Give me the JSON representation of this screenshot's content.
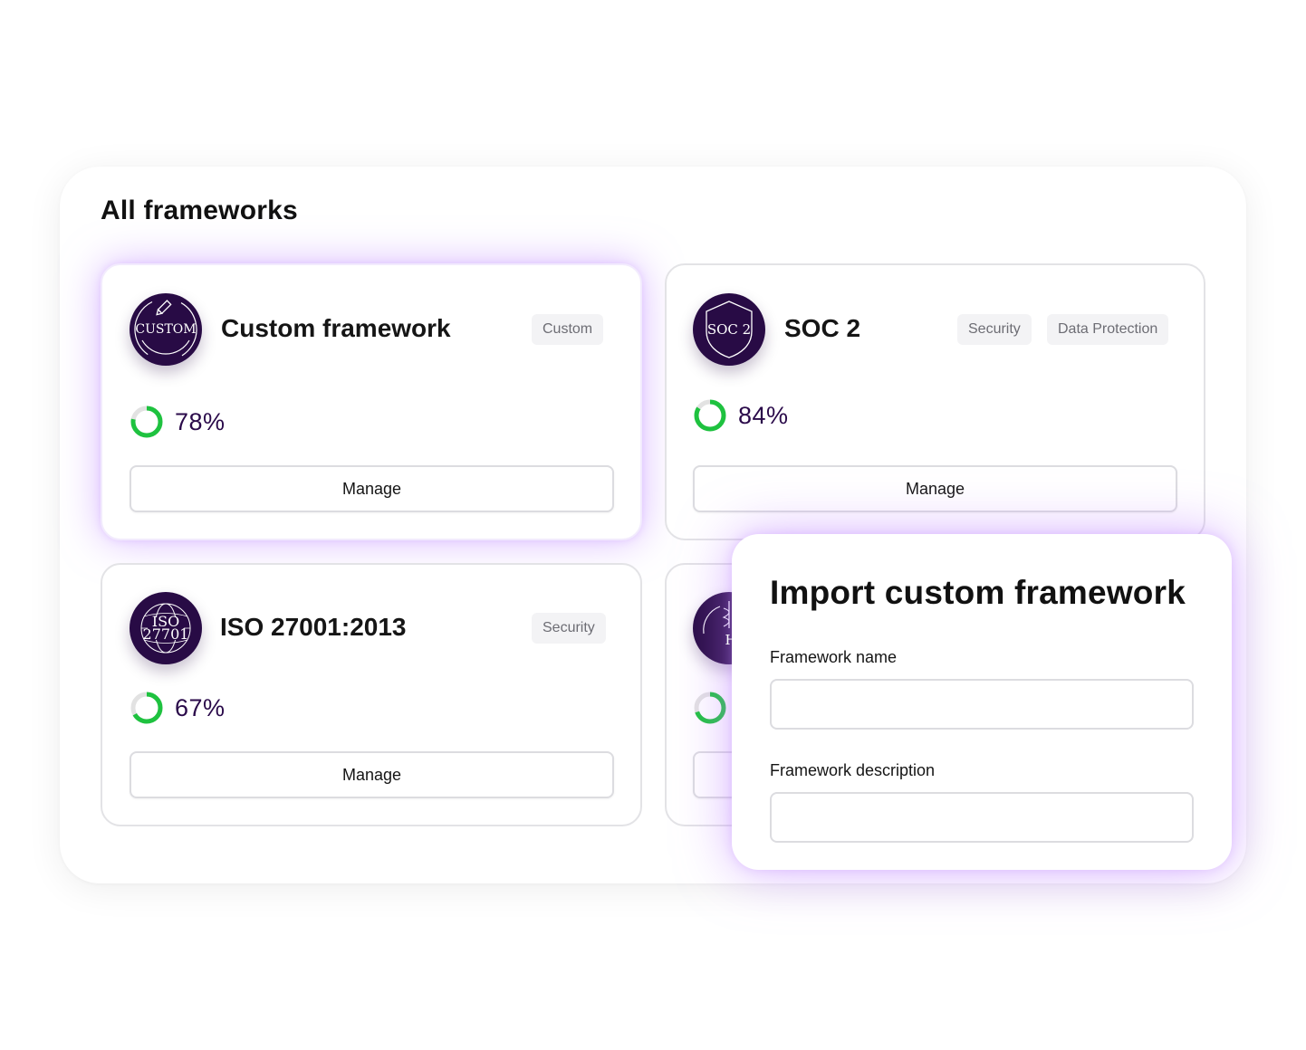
{
  "page": {
    "title": "All frameworks"
  },
  "colors": {
    "badge_bg": "#280b45",
    "progress_green": "#1ec23f",
    "progress_track": "#e2e2e2",
    "glow": "#ba80ff",
    "value_text": "#2a0a4a"
  },
  "frameworks": [
    {
      "badge_icon": "pencil-icon",
      "badge_text": "CUSTOM",
      "name": "Custom framework",
      "tags": [
        "Custom"
      ],
      "progress": 78,
      "progress_label": "78%",
      "manage_label": "Manage"
    },
    {
      "badge_icon": "shield-icon",
      "badge_text": "SOC 2",
      "name": "SOC 2",
      "tags": [
        "Security",
        "Data Protection"
      ],
      "progress": 84,
      "progress_label": "84%",
      "manage_label": "Manage"
    },
    {
      "badge_icon": "globe-icon",
      "badge_text_line1": "ISO",
      "badge_text_line2": "27701",
      "name": "ISO 27001:2013",
      "tags": [
        "Security"
      ],
      "progress": 67,
      "progress_label": "67%",
      "manage_label": "Manage"
    },
    {
      "badge_icon": "caduceus-icon",
      "badge_text": "HIP",
      "progress": 70
    }
  ],
  "import_modal": {
    "title": "Import custom framework",
    "name_label": "Framework name",
    "name_value": "",
    "description_label": "Framework description",
    "description_value": ""
  }
}
